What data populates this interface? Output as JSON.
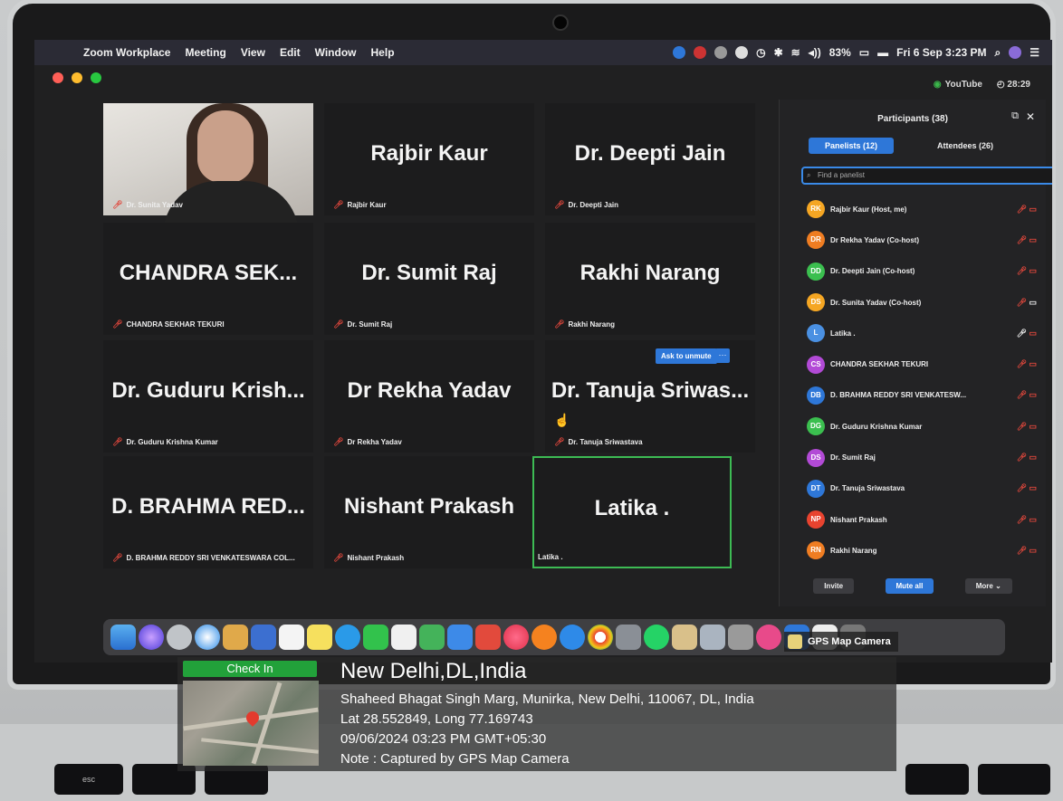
{
  "menubar": {
    "app": "Zoom Workplace",
    "items": [
      "Meeting",
      "View",
      "Edit",
      "Window",
      "Help"
    ],
    "battery": "83%",
    "datetime": "Fri 6 Sep  3:23 PM"
  },
  "topbar": {
    "youtube": "YouTube",
    "timer": "28:29"
  },
  "gallery": {
    "tiles": [
      {
        "big": "",
        "name": "Dr. Sunita Yadav",
        "video": true
      },
      {
        "big": "Rajbir Kaur",
        "name": "Rajbir Kaur"
      },
      {
        "big": "Dr. Deepti Jain",
        "name": "Dr. Deepti Jain"
      },
      {
        "big": "CHANDRA SEK...",
        "name": "CHANDRA SEKHAR TEKURI"
      },
      {
        "big": "Dr. Sumit Raj",
        "name": "Dr. Sumit Raj"
      },
      {
        "big": "Rakhi Narang",
        "name": "Rakhi Narang"
      },
      {
        "big": "Dr. Guduru Krish...",
        "name": "Dr. Guduru Krishna Kumar"
      },
      {
        "big": "Dr Rekha Yadav",
        "name": "Dr Rekha Yadav"
      },
      {
        "big": "Dr. Tanuja Sriwas...",
        "name": "Dr. Tanuja Sriwastava"
      },
      {
        "big": "D. BRAHMA RED...",
        "name": "D. BRAHMA REDDY SRI VENKATESWARA COL..."
      },
      {
        "big": "Nishant Prakash",
        "name": "Nishant Prakash"
      },
      {
        "big": "Latika .",
        "name": "Latika ."
      }
    ],
    "ask_unmute": "Ask to unmute",
    "more": "···"
  },
  "panel": {
    "title": "Participants (38)",
    "tab_panelists": "Panelists (12)",
    "tab_attendees": "Attendees (26)",
    "search_placeholder": "Find a panelist",
    "participants": [
      {
        "initials": "RK",
        "name": "Rajbir Kaur (Host, me)",
        "color": "#f5a623"
      },
      {
        "initials": "DR",
        "name": "Dr Rekha Yadav (Co-host)",
        "color": "#ef7d22"
      },
      {
        "initials": "DD",
        "name": "Dr. Deepti Jain (Co-host)",
        "color": "#3bbf4f"
      },
      {
        "initials": "DS",
        "name": "Dr. Sunita Yadav (Co-host)",
        "color": "#f5a623"
      },
      {
        "initials": "L",
        "name": "Latika .",
        "color": "#4a90e2"
      },
      {
        "initials": "CS",
        "name": "CHANDRA SEKHAR TEKURI",
        "color": "#b24ad6"
      },
      {
        "initials": "DB",
        "name": "D. BRAHMA REDDY SRI VENKATESW...",
        "color": "#2e77d8"
      },
      {
        "initials": "DG",
        "name": "Dr. Guduru Krishna Kumar",
        "color": "#3bbf4f"
      },
      {
        "initials": "DS",
        "name": "Dr. Sumit Raj",
        "color": "#b24ad6"
      },
      {
        "initials": "DT",
        "name": "Dr. Tanuja Sriwastava",
        "color": "#2e77d8"
      },
      {
        "initials": "NP",
        "name": "Nishant Prakash",
        "color": "#e8432f"
      },
      {
        "initials": "RN",
        "name": "Rakhi Narang",
        "color": "#ef7d22"
      }
    ],
    "invite": "Invite",
    "mute_all": "Mute all",
    "more": "More"
  },
  "gps": {
    "checkin": "Check In",
    "city": "New Delhi,DL,India",
    "address": "Shaheed Bhagat Singh Marg, Munirka, New Delhi, 110067, DL, India",
    "coords": "Lat 28.552849, Long 77.169743",
    "datetime": "09/06/2024 03:23 PM GMT+05:30",
    "note": "Note : Captured by GPS Map Camera",
    "badge": "GPS Map Camera"
  },
  "keyboard": {
    "esc": "esc"
  }
}
